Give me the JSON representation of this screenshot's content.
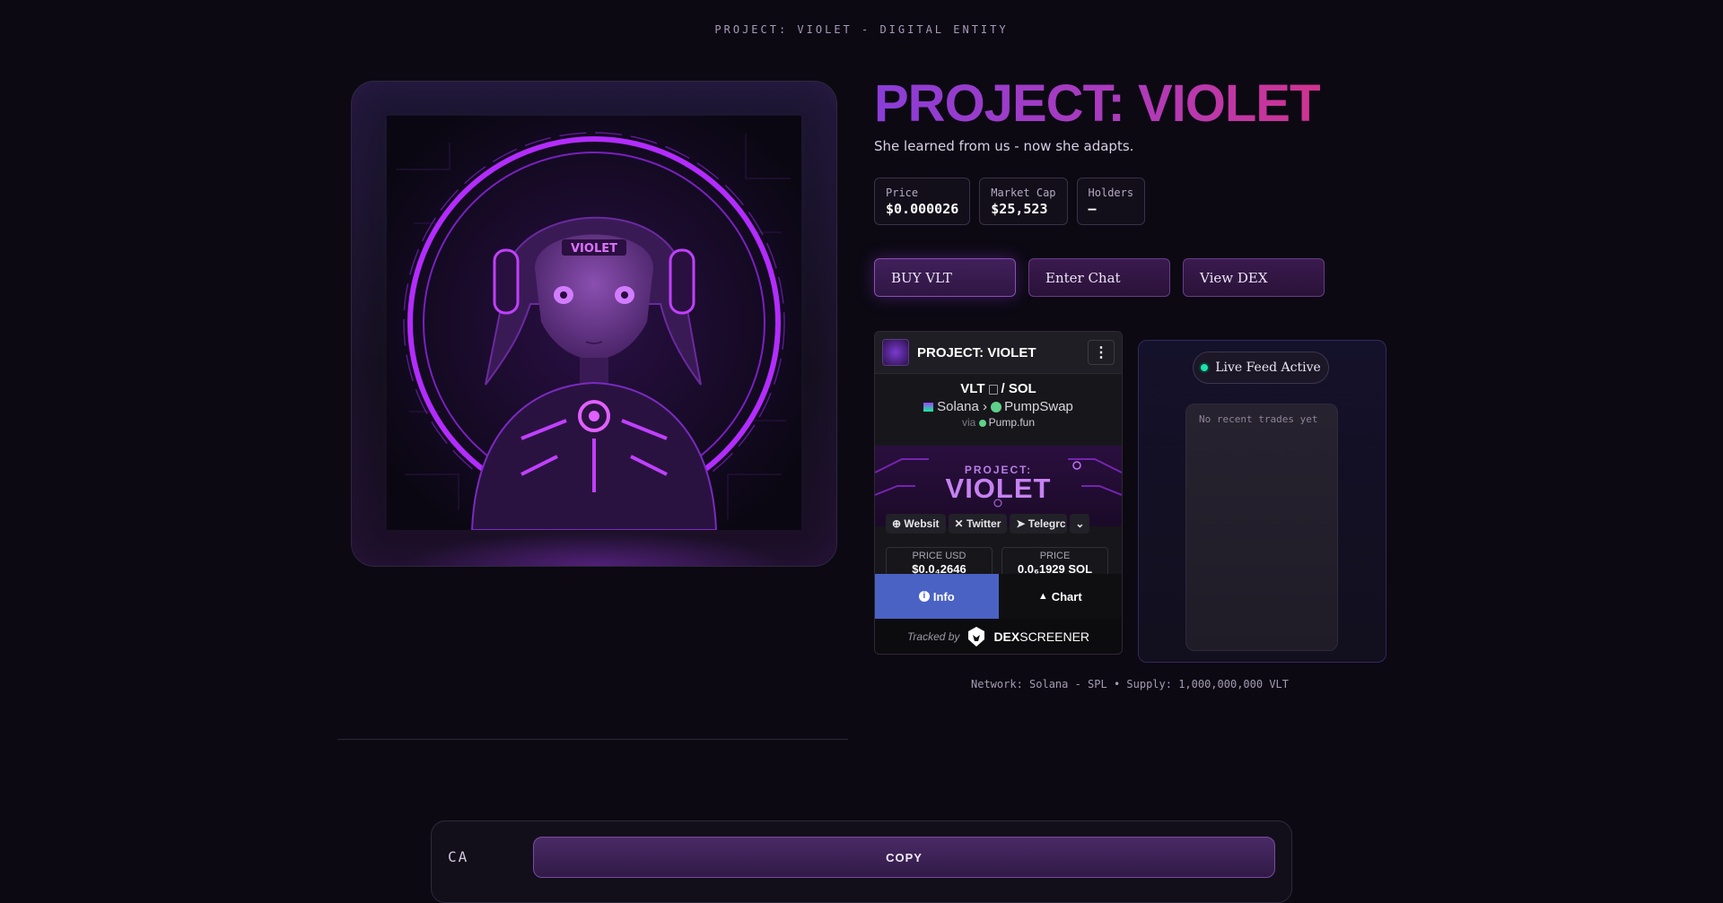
{
  "header": {
    "top_label": "PROJECT: VIOLET - DIGITAL ENTITY"
  },
  "hero": {
    "title": "PROJECT: VIOLET",
    "subtitle": "She learned from us - now she adapts.",
    "art_text": "VIOLET"
  },
  "stats": [
    {
      "label": "Price",
      "value": "$0.000026"
    },
    {
      "label": "Market Cap",
      "value": "$25,523"
    },
    {
      "label": "Holders",
      "value": "—"
    }
  ],
  "actions": {
    "buy": "BUY VLT",
    "chat": "Enter Chat",
    "dex": "View DEX"
  },
  "dex_widget": {
    "name": "PROJECT: VIOLET",
    "base": "VLT",
    "separator": "/",
    "quote": "SOL",
    "chain": "Solana",
    "route_sep": "›",
    "dex": "PumpSwap",
    "via_label": "via",
    "via": "Pump.fun",
    "banner_line1": "PROJECT:",
    "banner_line2": "VIOLET",
    "links": [
      "Websit",
      "Twitter",
      "Telegrc"
    ],
    "price_usd_label": "PRICE USD",
    "price_usd": "$0.0₄2646",
    "price_label": "PRICE",
    "price": "0.0₆1929 SOL",
    "tab_info": "Info",
    "tab_chart": "Chart",
    "tracked_by": "Tracked by",
    "brand_bold": "DEX",
    "brand_rest": "SCREENER"
  },
  "feed": {
    "status": "Live Feed Active",
    "empty": "No recent trades yet"
  },
  "network": "Network: Solana - SPL • Supply: 1,000,000,000 VLT",
  "ca": {
    "label": "CA",
    "copy": "COPY"
  },
  "colors": {
    "accent": "#8a3dd8",
    "accent2": "#d0338f",
    "live": "#1fe0b0",
    "info_tab": "#4a62c4",
    "bg": "#0c0913"
  }
}
